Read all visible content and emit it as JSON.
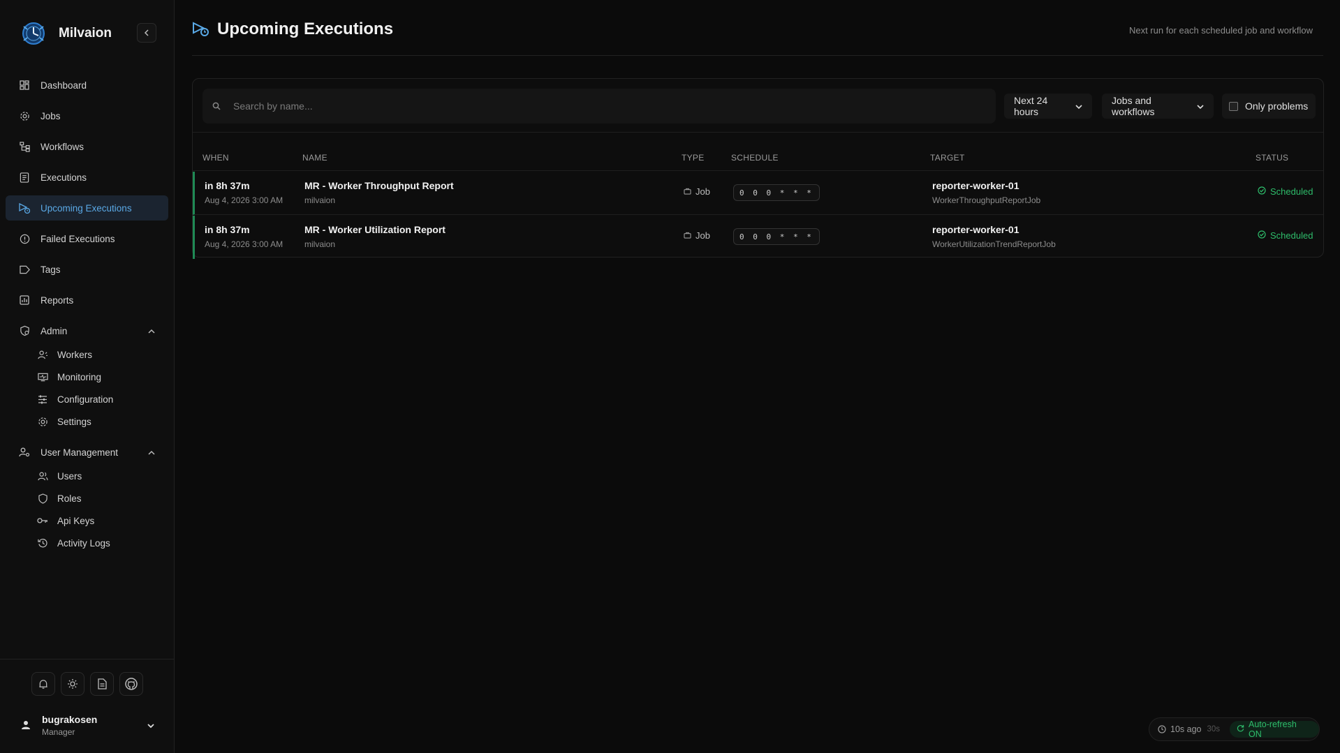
{
  "brand": {
    "name": "Milvaion"
  },
  "nav": [
    {
      "label": "Dashboard",
      "icon": "dashboard-icon"
    },
    {
      "label": "Jobs",
      "icon": "jobs-gear-icon"
    },
    {
      "label": "Workflows",
      "icon": "workflow-icon"
    },
    {
      "label": "Executions",
      "icon": "executions-icon"
    },
    {
      "label": "Upcoming Executions",
      "icon": "upcoming-icon",
      "active": true
    },
    {
      "label": "Failed Executions",
      "icon": "alert-circle-icon"
    },
    {
      "label": "Tags",
      "icon": "tag-icon"
    },
    {
      "label": "Reports",
      "icon": "chart-icon"
    }
  ],
  "admin": {
    "label": "Admin",
    "items": [
      {
        "label": "Workers"
      },
      {
        "label": "Monitoring"
      },
      {
        "label": "Configuration"
      },
      {
        "label": "Settings"
      }
    ]
  },
  "user_management": {
    "label": "User Management",
    "items": [
      {
        "label": "Users"
      },
      {
        "label": "Roles"
      },
      {
        "label": "Api Keys"
      },
      {
        "label": "Activity Logs"
      }
    ]
  },
  "user": {
    "name": "bugrakosen",
    "role": "Manager"
  },
  "page": {
    "title": "Upcoming Executions",
    "subtitle": "Next run for each scheduled job and workflow"
  },
  "filters": {
    "search_placeholder": "Search by name...",
    "time_range": "Next 24 hours",
    "kind": "Jobs and workflows",
    "only_problems": "Only problems",
    "only_problems_checked": false
  },
  "table": {
    "columns": [
      "WHEN",
      "NAME",
      "TYPE",
      "SCHEDULE",
      "TARGET",
      "STATUS"
    ],
    "rows": [
      {
        "when": "in 8h 37m",
        "date": "Aug 4, 2026 3:00 AM",
        "name": "MR - Worker Throughput Report",
        "owner": "milvaion",
        "type": "Job",
        "schedule": "0 0 0 * * *",
        "target": "reporter-worker-01",
        "target_job": "WorkerThroughputReportJob",
        "status": "Scheduled"
      },
      {
        "when": "in 8h 37m",
        "date": "Aug 4, 2026 3:00 AM",
        "name": "MR - Worker Utilization Report",
        "owner": "milvaion",
        "type": "Job",
        "schedule": "0 0 0 * * *",
        "target": "reporter-worker-01",
        "target_job": "WorkerUtilizationTrendReportJob",
        "status": "Scheduled"
      }
    ]
  },
  "refresh": {
    "last": "10s ago",
    "interval": "30s",
    "auto": "Auto-refresh ON"
  },
  "colors": {
    "accent": "#5aa9e6",
    "success": "#2ebd6b",
    "background": "#0b0b0b"
  }
}
